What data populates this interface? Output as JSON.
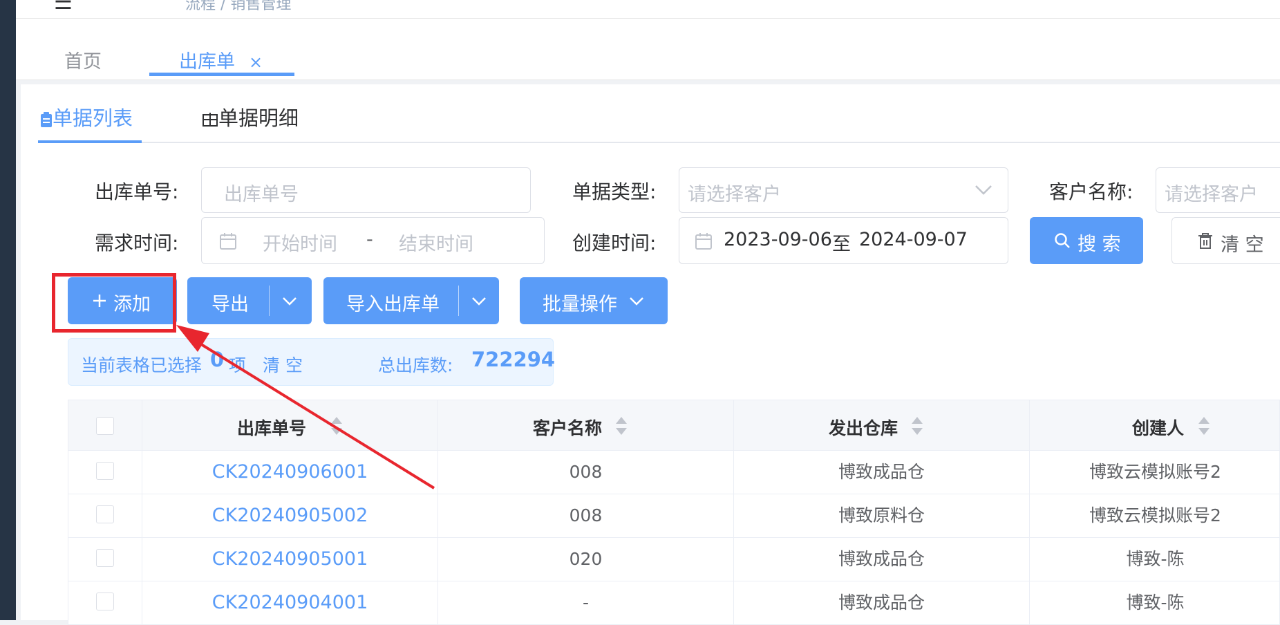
{
  "breadcrumb": "流程 / 销售管理",
  "tabs": [
    {
      "label": "首页"
    },
    {
      "label": "出库单",
      "close": "×"
    }
  ],
  "subtabs": [
    {
      "label": "单据列表"
    },
    {
      "label": "单据明细"
    }
  ],
  "filters": {
    "order_no_label": "出库单号:",
    "order_no_placeholder": "出库单号",
    "doc_type_label": "单据类型:",
    "doc_type_placeholder": "请选择客户",
    "customer_label": "客户名称:",
    "customer_placeholder": "请选择客户",
    "demand_time_label": "需求时间:",
    "demand_start_placeholder": "开始时间",
    "range_sep": "-",
    "demand_end_placeholder": "结束时间",
    "create_time_label": "创建时间:",
    "create_start": "2023-09-06",
    "create_sep": "至",
    "create_end": "2024-09-07",
    "search_label": "搜 索",
    "clear_label": "清 空"
  },
  "actions": {
    "add_label": "添加",
    "export_label": "导出",
    "import_label": "导入出库单",
    "batch_label": "批量操作"
  },
  "info": {
    "selected_prefix": "当前表格已选择",
    "selected_count": "0",
    "selected_suffix": "项",
    "clear_label": "清 空",
    "total_label": "总出库数:",
    "total_value": "722294"
  },
  "table": {
    "headers": [
      "出库单号",
      "客户名称",
      "发出仓库",
      "创建人"
    ],
    "rows": [
      {
        "no": "CK20240906001",
        "customer": "008",
        "warehouse": "博致成品仓",
        "creator": "博致云模拟账号2"
      },
      {
        "no": "CK20240905002",
        "customer": "008",
        "warehouse": "博致原料仓",
        "creator": "博致云模拟账号2"
      },
      {
        "no": "CK20240905001",
        "customer": "020",
        "warehouse": "博致成品仓",
        "creator": "博致-陈"
      },
      {
        "no": "CK20240904001",
        "customer": "-",
        "warehouse": "博致成品仓",
        "creator": "博致-陈"
      }
    ]
  },
  "colors": {
    "primary": "#5a9cf8",
    "annotation_red": "#e8262e"
  }
}
